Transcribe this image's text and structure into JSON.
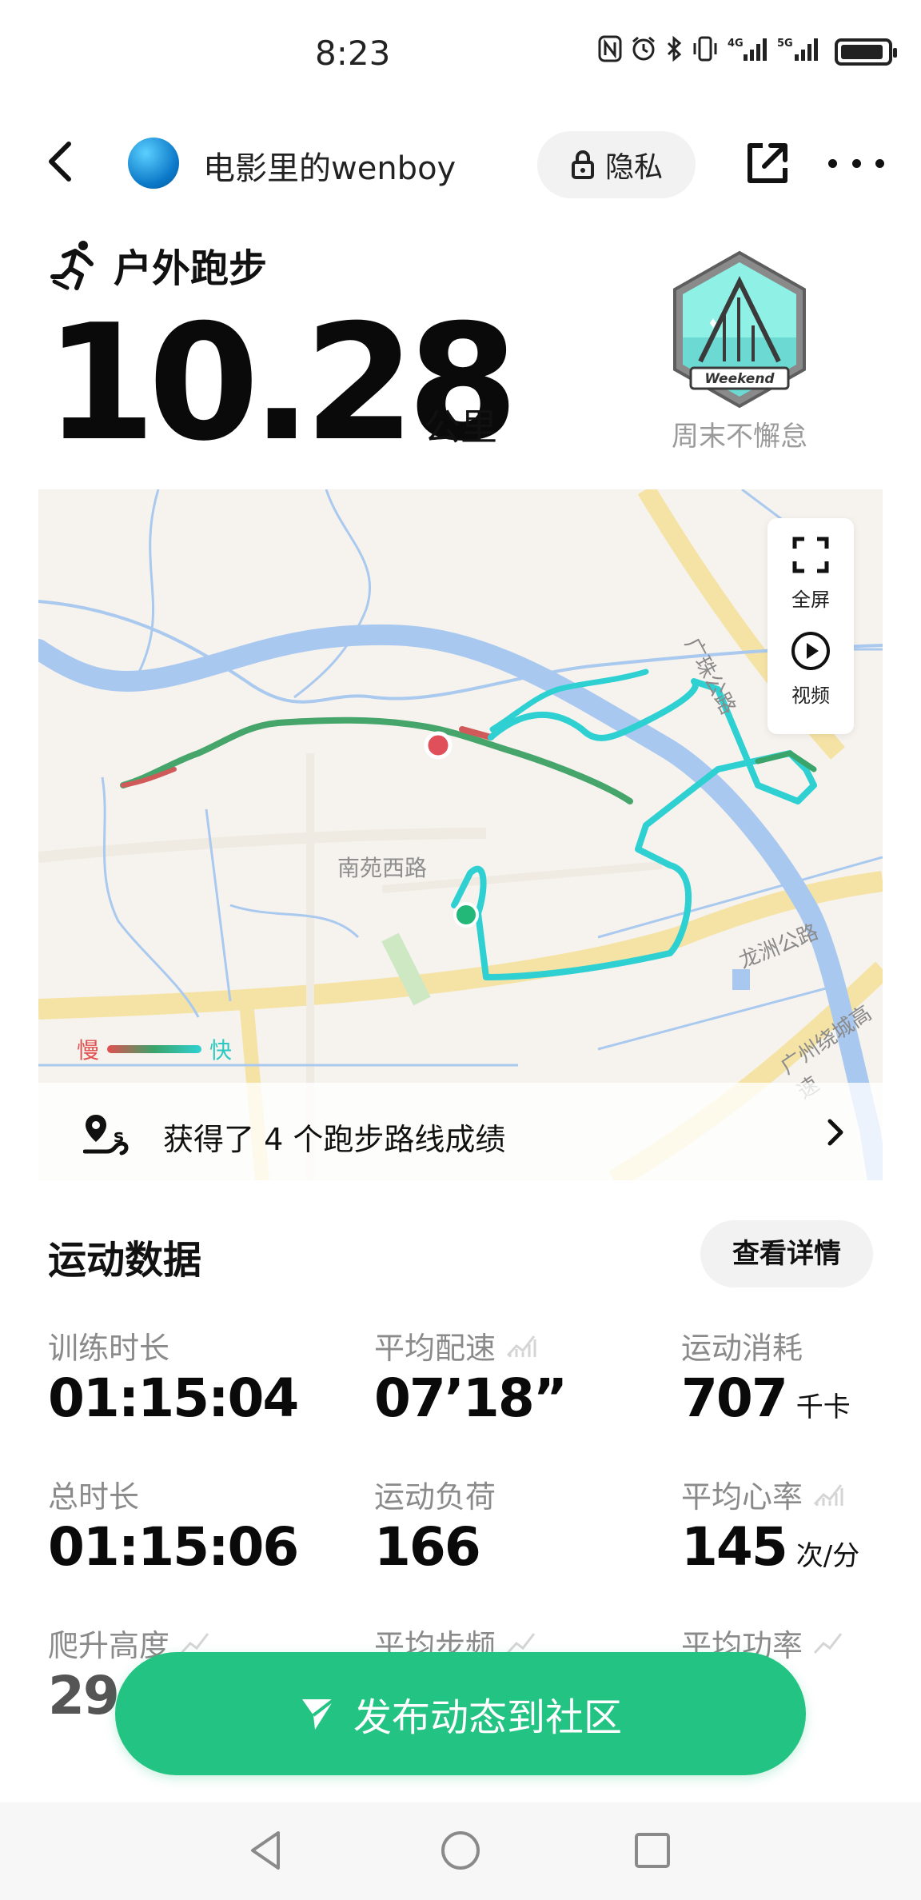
{
  "status_bar": {
    "time": "8:23",
    "icons": [
      "nfc-icon",
      "alarm-icon",
      "bluetooth-icon",
      "vibrate-icon",
      "4g-signal-icon",
      "5g-signal-icon",
      "battery-icon"
    ],
    "network_4g": "4G",
    "network_5g": "5G"
  },
  "header": {
    "username": "电影里的wenboy",
    "privacy_label": "隐私"
  },
  "activity": {
    "type_label": "户外跑步",
    "distance": "10.28",
    "unit": "公里",
    "badge_text": "Weekend",
    "badge_label": "周末不懈怠"
  },
  "map": {
    "street_label": "南苑西路",
    "road_labels": [
      "广珠公路",
      "龙洲公路",
      "广州绕城高速"
    ],
    "controls": {
      "fullscreen_label": "全屏",
      "video_label": "视频"
    },
    "legend": {
      "slow": "慢",
      "fast": "快"
    },
    "route_records_text": "获得了 4 个跑步路线成绩",
    "colors": {
      "route_fast": "#2fd0d2",
      "route_mid": "#3aa46a",
      "route_slow": "#e05050",
      "river": "#a9c8f0"
    }
  },
  "stats": {
    "title": "运动数据",
    "details_button": "查看详情",
    "items": [
      {
        "label": "训练时长",
        "value": "01:15:04",
        "unit": ""
      },
      {
        "label": "平均配速",
        "value": "07’18”",
        "unit": ""
      },
      {
        "label": "运动消耗",
        "value": "707",
        "unit": "千卡"
      },
      {
        "label": "总时长",
        "value": "01:15:06",
        "unit": ""
      },
      {
        "label": "运动负荷",
        "value": "166",
        "unit": ""
      },
      {
        "label": "平均心率",
        "value": "145",
        "unit": "次/分"
      },
      {
        "label": "爬升高度",
        "value": "29",
        "unit": ""
      },
      {
        "label": "平均步频",
        "value": "",
        "unit": ""
      },
      {
        "label": "平均功率",
        "value": "",
        "unit": ""
      }
    ]
  },
  "publish": {
    "label": "发布动态到社区",
    "color": "#23c383"
  }
}
